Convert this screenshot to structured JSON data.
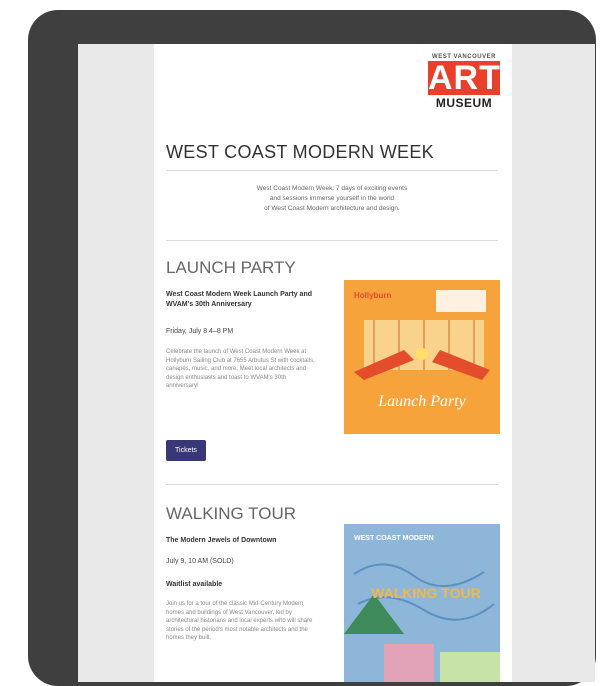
{
  "logo": {
    "small": "WEST VANCOUVER",
    "big": "ART",
    "museum": "MUSEUM"
  },
  "header": {
    "title": "WEST COAST MODERN WEEK"
  },
  "intro": {
    "lines": [
      "West Coast Modern Week: 7 days of exciting events",
      "and sessions immerse yourself in the world",
      "of West Coast Modern architecture and design."
    ]
  },
  "launch": {
    "heading": "LAUNCH PARTY",
    "event_title": "West Coast Modern Week Launch Party and WVAM's 30th Anniversary",
    "date": "Friday, July 8 4–8 PM",
    "description": "Celebrate the launch of West Coast Modern Week at Hollyburn Sailing Club at 7655 Arbutus St with cocktails, canapés, music, and more. Meet local architects and design enthusiasts and toast to WVAM's 30th anniversary!",
    "button_label": "Tickets",
    "poster": {
      "brand": "Hollyburn",
      "title": "Launch Party",
      "colors": {
        "bg": "#f5a33a",
        "accent": "#e34d2b"
      }
    }
  },
  "walking": {
    "heading": "WALKING TOUR",
    "event_title": "The Modern Jewels of Downtown",
    "date": "July 9, 10 AM (SOLD)",
    "status": "Waitlist available",
    "description": "Join us for a tour of the classic Mid-Century Modern homes and buildings of West Vancouver, led by architectural historians and local experts who will share stories of the period's most notable architects and the homes they built.",
    "poster": {
      "brand": "WEST COAST MODERN",
      "title": "WALKING TOUR",
      "colors": {
        "bg": "#8db6d8",
        "accent": "#f1b94a"
      }
    }
  }
}
